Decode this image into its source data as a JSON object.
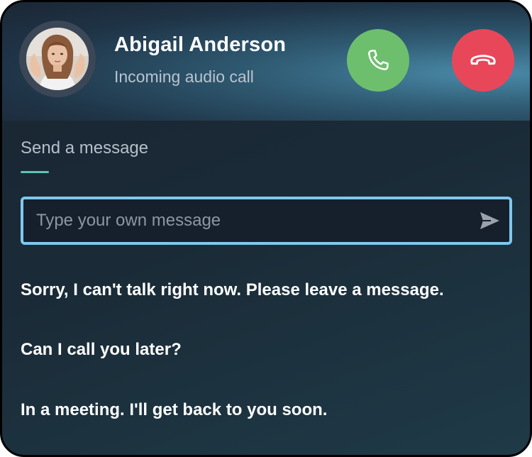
{
  "caller": {
    "name": "Abigail Anderson",
    "status": "Incoming audio call"
  },
  "actions": {
    "accept_icon": "phone-icon",
    "decline_icon": "phone-hangup-icon",
    "accept_color": "#6dbf6e",
    "decline_color": "#e8475a"
  },
  "message": {
    "section_label": "Send a message",
    "input_placeholder": "Type your own message",
    "input_value": "",
    "send_icon": "send-icon"
  },
  "quick_replies": [
    "Sorry, I can't talk right now. Please leave a message.",
    "Can I call you later?",
    "In a meeting. I'll get back to you soon."
  ],
  "colors": {
    "accent": "#5fc3b2",
    "input_border": "#7ec8ef"
  }
}
